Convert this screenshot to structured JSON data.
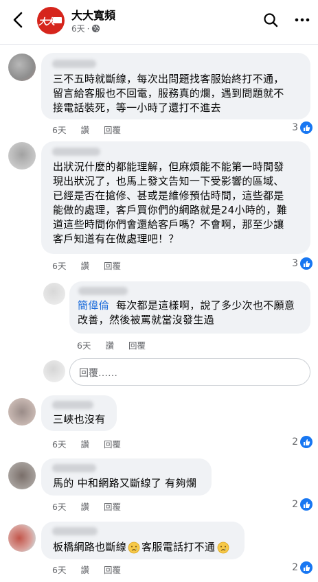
{
  "header": {
    "page_name": "大大寬頻",
    "post_time": "6天",
    "meta_separator": "·",
    "logo_text": "大大"
  },
  "comments": [
    {
      "text_lines": [
        "三不五時就斷線，每次出問題找客服始終打不通，",
        "留言給客服也不回電，服務真的爛，遇到問題就不",
        "接電話裝死，等一小時了還打不進去"
      ],
      "time": "6天",
      "like_label": "讚",
      "reply_label": "回覆",
      "likes": "3"
    },
    {
      "text_lines": [
        "出狀況什麼的都能理解，但麻煩能不能第一時間發",
        "現出狀況了，也馬上發文告知一下受影響的區域、",
        "已經是否在搶修、甚或是維修預估時間，這些都是",
        "能做的處理，客戶買你們的網路就是24小時的，難",
        "道這些時間你們會還給客戶嗎？不會啊，那至少讓",
        "客戶知道有在做處理吧！？"
      ],
      "time": "6天",
      "like_label": "讚",
      "reply_label": "回覆",
      "likes": "3",
      "reply": {
        "author": "簡偉倫",
        "text_line1": "每次都是這樣啊，說了多少次也不願意",
        "text_line2": "改善，然後被罵就當沒發生過",
        "time": "6天",
        "like_label": "讚",
        "reply_label": "回覆"
      },
      "reply_placeholder": "回覆……"
    },
    {
      "text_lines": [
        "三峽也沒有"
      ],
      "time": "6天",
      "like_label": "讚",
      "reply_label": "回覆",
      "likes": "2"
    },
    {
      "text_lines": [
        "馬的 中和網路又斷線了 有夠爛"
      ],
      "time": "6天",
      "like_label": "讚",
      "reply_label": "回覆",
      "likes": "2"
    },
    {
      "text_part1": "板橋網路也斷線",
      "text_part2": "客服電話打不通",
      "emoji": "sad-face-emoji",
      "time": "6天",
      "like_label": "讚",
      "reply_label": "回覆",
      "likes": "2"
    }
  ],
  "colors": {
    "accent_blue": "#1877f2",
    "reply_name": "#216fdb",
    "logo_red": "#d6251c",
    "bubble_bg": "#f0f2f5"
  }
}
